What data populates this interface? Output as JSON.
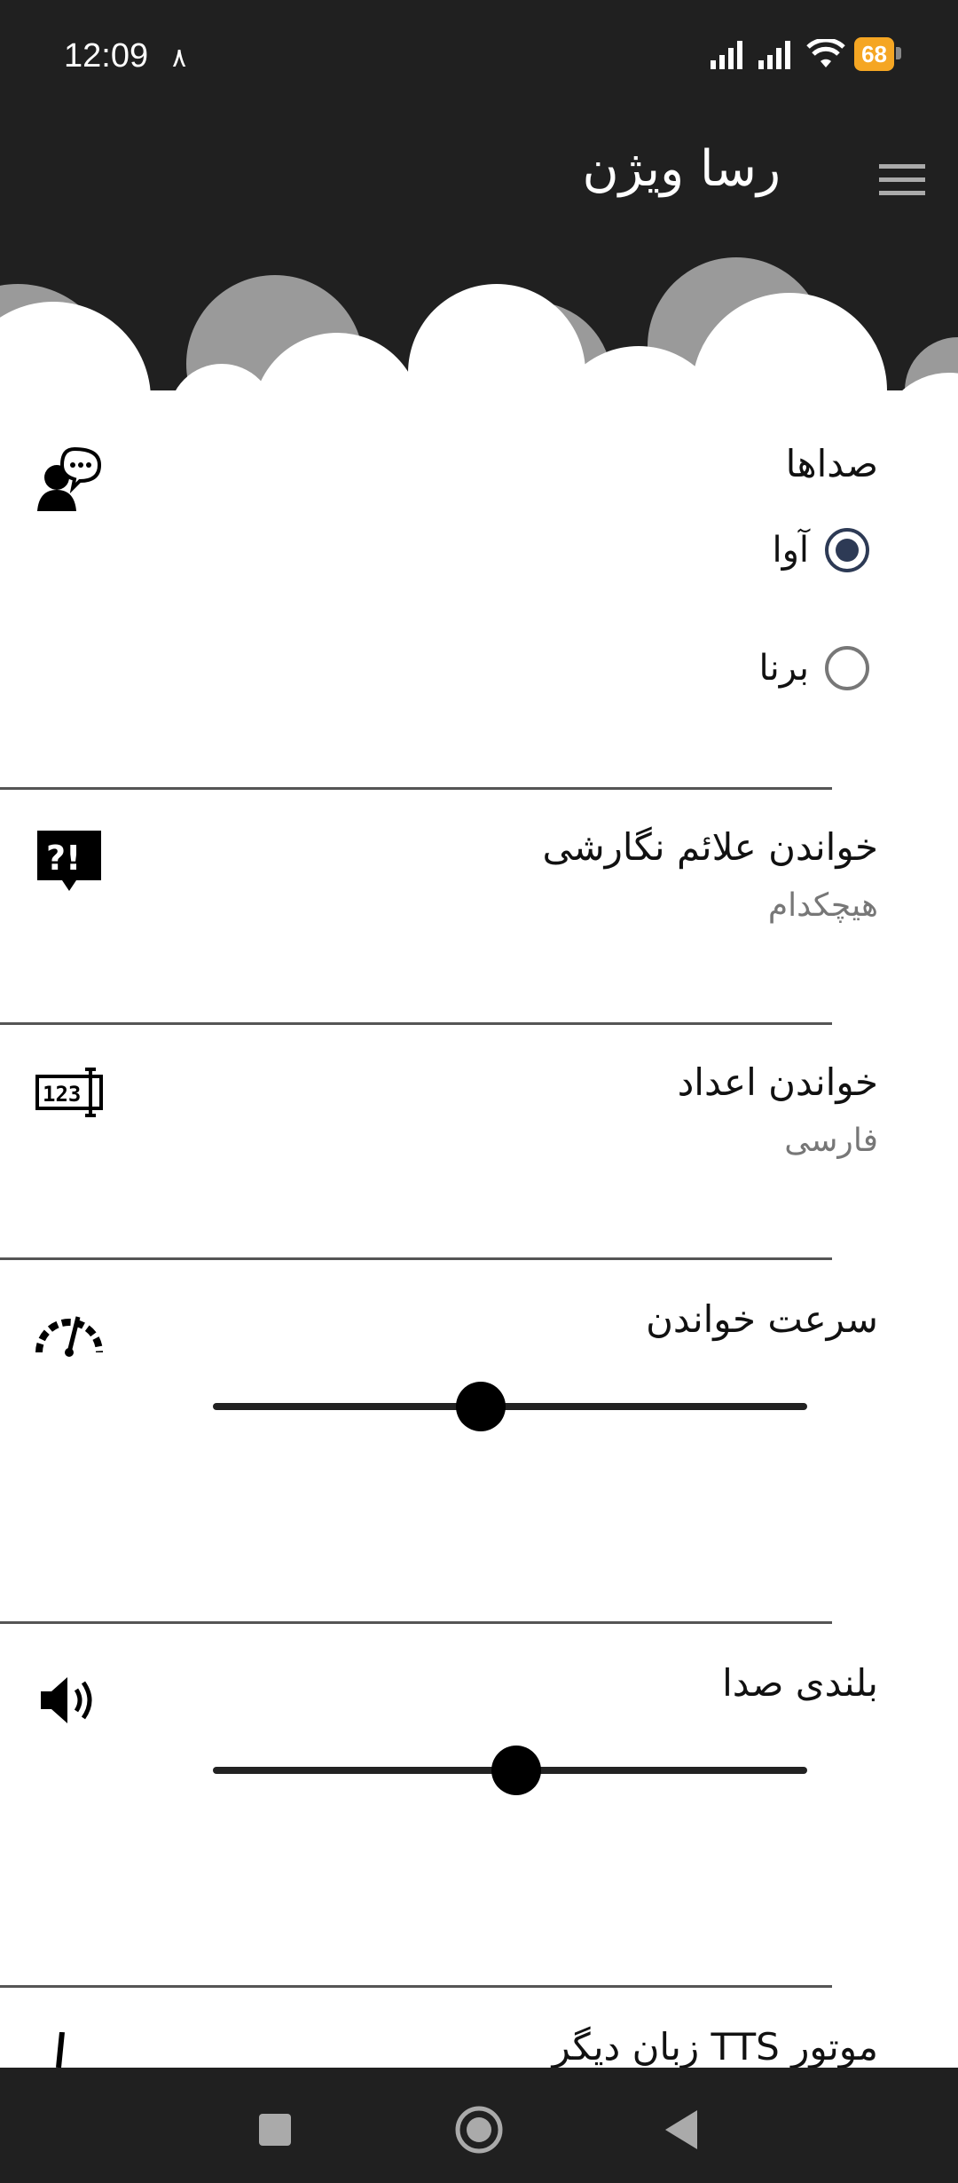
{
  "status": {
    "time": "12:09",
    "extra": "٨",
    "battery": "68"
  },
  "app": {
    "title": "رسا ویژن",
    "menu_icon": "hamburger-menu-icon"
  },
  "voices": {
    "title": "صداها",
    "icon": "speaking-person-icon",
    "options": [
      {
        "label": "آوا",
        "checked": true
      },
      {
        "label": "برنا",
        "checked": false
      }
    ]
  },
  "punctuation": {
    "title": "خواندن علائم نگارشی",
    "value": "هیچکدام",
    "icon": "punctuation-bubble-icon"
  },
  "numbers": {
    "title": "خواندن اعداد",
    "value": "فارسی",
    "icon": "numbers-icon"
  },
  "speed": {
    "title": "سرعت خواندن",
    "icon": "speedometer-icon",
    "level": 0.45
  },
  "volume": {
    "title": "بلندی صدا",
    "icon": "speaker-icon",
    "level": 0.51
  },
  "tts": {
    "title": "موتور TTS زبان دیگر"
  },
  "colors": {
    "dark": "#202020",
    "accent": "#2d3a55",
    "battery": "#f5a623"
  }
}
